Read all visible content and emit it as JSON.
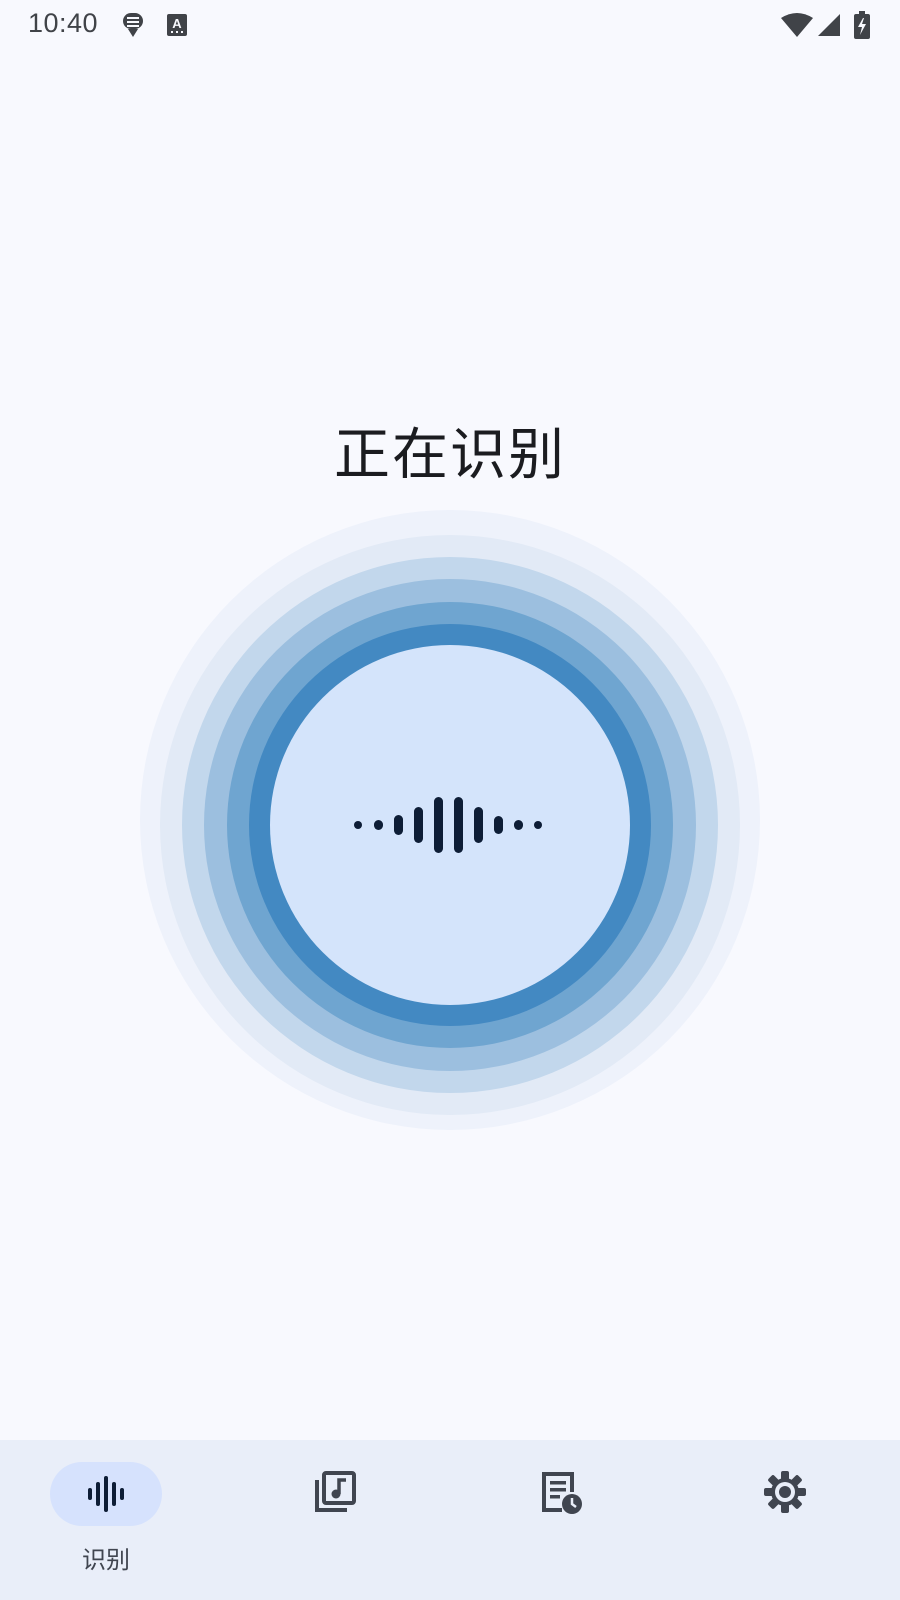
{
  "status_bar": {
    "time": "10:40",
    "left_icons": [
      "microphone-app-icon",
      "text-a-icon"
    ],
    "right_icons": [
      "wifi-icon",
      "cellular-signal-icon",
      "battery-charging-icon"
    ]
  },
  "main": {
    "title": "正在识别",
    "recognize_button_icon": "sound-wave-icon"
  },
  "bottom_nav": {
    "items": [
      {
        "label": "识别",
        "icon": "sound-wave-icon",
        "active": true
      },
      {
        "label": "",
        "icon": "music-library-icon",
        "active": false
      },
      {
        "label": "",
        "icon": "history-list-icon",
        "active": false
      },
      {
        "label": "",
        "icon": "settings-gear-icon",
        "active": false
      }
    ]
  },
  "colors": {
    "background": "#f8f9fe",
    "accent": "#4389c2",
    "inner_circle": "#d4e4fb",
    "nav_background": "#e9eef9",
    "nav_active_pill": "#d6e2fd",
    "wave": "#0d1d36"
  }
}
